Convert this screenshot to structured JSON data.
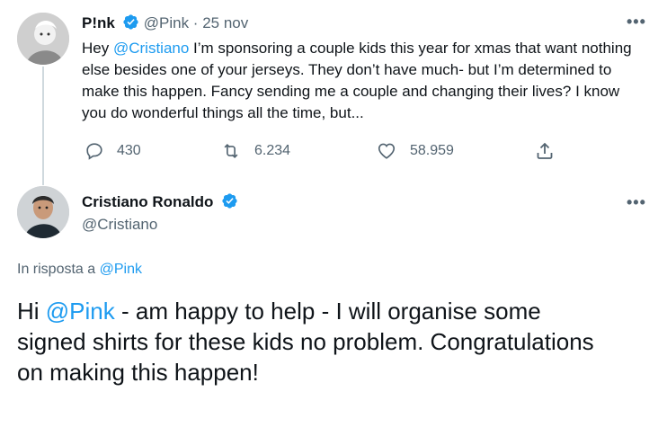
{
  "tweet1": {
    "name": "P!nk",
    "handle": "@Pink",
    "date_sep": " · ",
    "date": "25 nov",
    "text": {
      "p1": "Hey ",
      "mention": "@Cristiano",
      "p2": " I’m sponsoring a couple kids this year for xmas that want nothing else besides one of your jerseys. They don’t have much- but I’m determined to make this happen. Fancy sending me a couple and changing their lives? I know you do wonderful things all the time, but..."
    },
    "more_label": "•••",
    "replies": "430",
    "retweets": "6.234",
    "likes": "58.959"
  },
  "tweet2": {
    "name": "Cristiano Ronaldo",
    "handle": "@Cristiano",
    "more_label": "•••",
    "reply_prefix": "In risposta a ",
    "reply_mention": "@Pink",
    "text": {
      "p1": "Hi ",
      "mention": "@Pink",
      "p2": " - am happy to help - I will organise some signed shirts for these kids no problem. Congratulations on making this happen!"
    }
  },
  "colors": {
    "accent": "#1d9bf0",
    "secondary_text": "#536471",
    "primary_text": "#0f1419"
  }
}
